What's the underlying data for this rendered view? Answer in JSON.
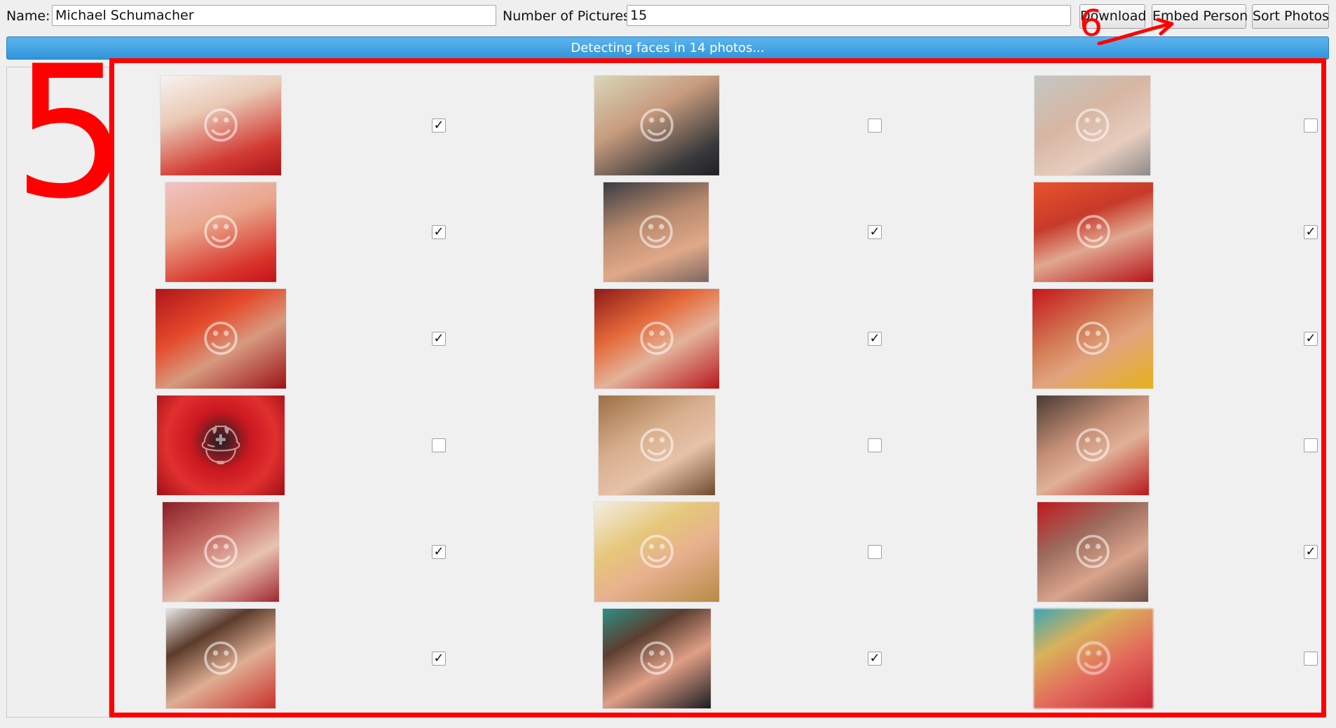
{
  "form": {
    "name_label": "Name:",
    "name_value": "Michael Schumacher",
    "count_label": "Number of Pictures:",
    "count_value": "15"
  },
  "buttons": {
    "download": "Download",
    "embed": "Embed Person",
    "sort": "Sort Photos"
  },
  "progress": {
    "text": "Detecting faces in 14 photos..."
  },
  "annotations": {
    "box_number": "5",
    "arrow_number": "6",
    "color": "#ff0000"
  },
  "photos": [
    {
      "checked": true,
      "icon": "face-photo"
    },
    {
      "checked": false,
      "icon": "face-photo"
    },
    {
      "checked": false,
      "icon": "face-photo"
    },
    {
      "checked": true,
      "icon": "face-photo"
    },
    {
      "checked": true,
      "icon": "face-photo"
    },
    {
      "checked": true,
      "icon": "face-photo"
    },
    {
      "checked": true,
      "icon": "face-photo"
    },
    {
      "checked": true,
      "icon": "face-photo"
    },
    {
      "checked": true,
      "icon": "face-photo"
    },
    {
      "checked": false,
      "icon": "helmet-photo"
    },
    {
      "checked": false,
      "icon": "face-photo"
    },
    {
      "checked": false,
      "icon": "face-photo"
    },
    {
      "checked": true,
      "icon": "face-photo"
    },
    {
      "checked": false,
      "icon": "face-photo"
    },
    {
      "checked": true,
      "icon": "face-photo"
    },
    {
      "checked": true,
      "icon": "face-photo"
    },
    {
      "checked": true,
      "icon": "face-photo"
    },
    {
      "checked": false,
      "icon": "blurred-photo"
    }
  ]
}
